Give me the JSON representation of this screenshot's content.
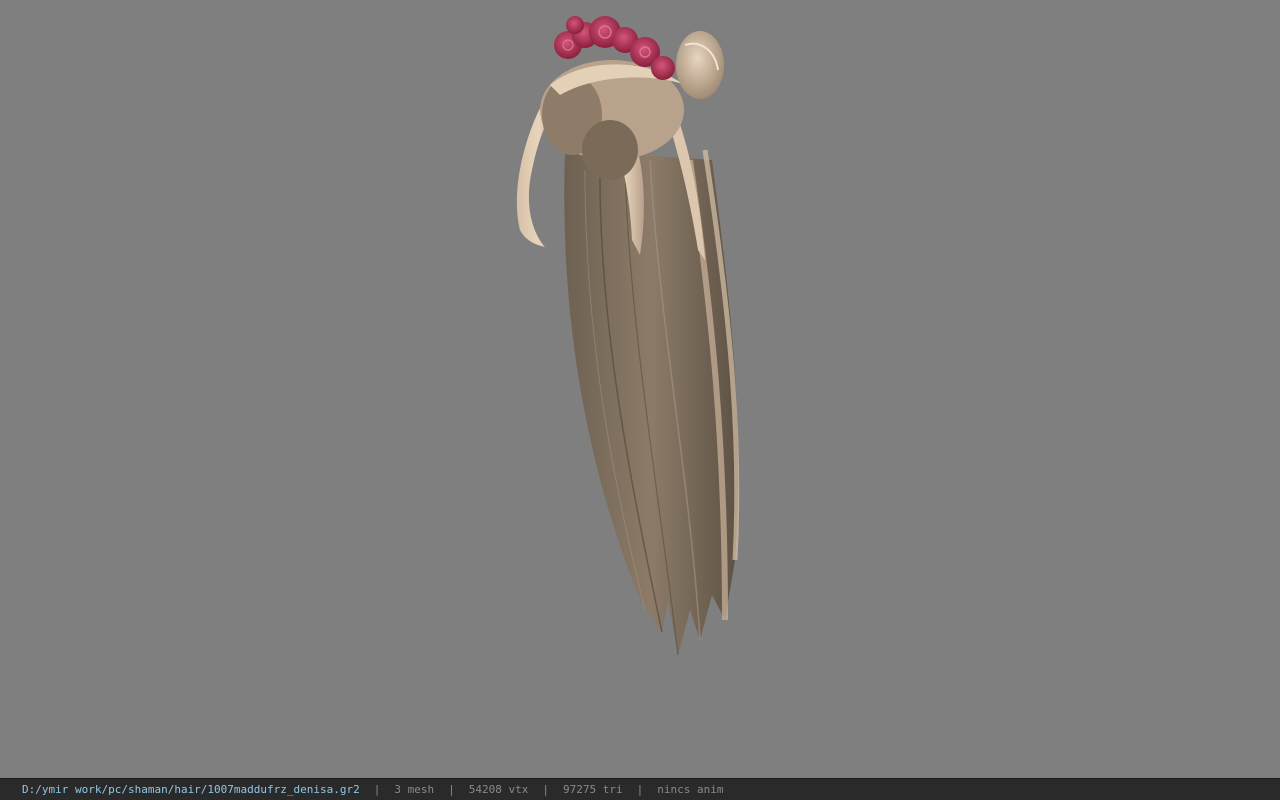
{
  "viewport": {
    "background_color": "#7f7f7f",
    "model": {
      "icon": "hair-model-render",
      "hair_color": "#b09880",
      "flower_color": "#b03455"
    }
  },
  "statusbar": {
    "file_path": "D:/ymir work/pc/shaman/hair/1007maddufrz_denisa.gr2",
    "separator": "|",
    "mesh_count": "3 mesh",
    "vertex_count": "54208 vtx",
    "triangle_count": "97275 tri",
    "anim_status": "nincs anim",
    "path_color": "#8ec7e6",
    "text_color": "#8a8a8a"
  }
}
